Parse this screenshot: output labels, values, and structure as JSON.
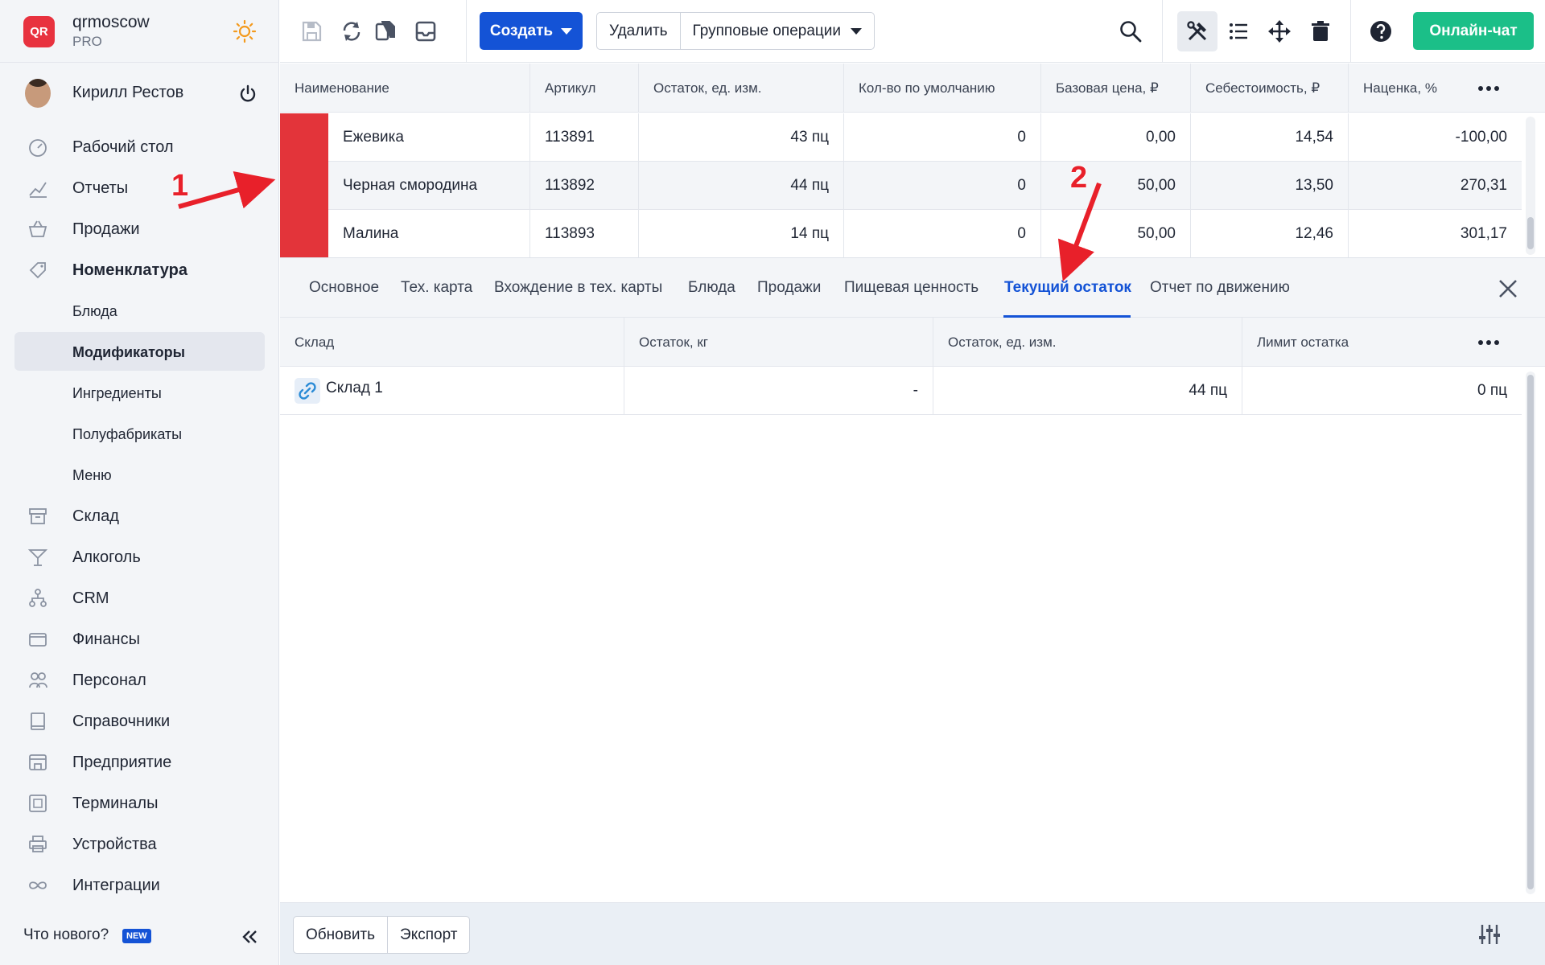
{
  "brand": {
    "name": "qrmoscow",
    "plan": "PRO",
    "logo_text": "QR"
  },
  "user": {
    "name": "Кирилл Рестов"
  },
  "nav": {
    "items": [
      {
        "label": "Рабочий стол",
        "icon": "dashboard-icon"
      },
      {
        "label": "Отчеты",
        "icon": "chart-icon"
      },
      {
        "label": "Продажи",
        "icon": "basket-icon"
      },
      {
        "label": "Номенклатура",
        "icon": "tag-icon"
      },
      {
        "label": "Блюда"
      },
      {
        "label": "Модификаторы"
      },
      {
        "label": "Ингредиенты"
      },
      {
        "label": "Полуфабрикаты"
      },
      {
        "label": "Меню"
      },
      {
        "label": "Склад",
        "icon": "archive-icon"
      },
      {
        "label": "Алкоголь",
        "icon": "cocktail-icon"
      },
      {
        "label": "CRM",
        "icon": "hierarchy-icon"
      },
      {
        "label": "Финансы",
        "icon": "wallet-icon"
      },
      {
        "label": "Персонал",
        "icon": "people-icon"
      },
      {
        "label": "Справочники",
        "icon": "book-icon"
      },
      {
        "label": "Предприятие",
        "icon": "store-icon"
      },
      {
        "label": "Терминалы",
        "icon": "qr-icon"
      },
      {
        "label": "Устройства",
        "icon": "printer-icon"
      },
      {
        "label": "Интеграции",
        "icon": "infinity-icon"
      }
    ],
    "whats_new": "Что нового?",
    "new_badge": "NEW"
  },
  "toolbar": {
    "create": "Создать",
    "delete": "Удалить",
    "group_ops": "Групповые операции",
    "chat": "Онлайн-чат"
  },
  "grid": {
    "columns": [
      "Наименование",
      "Артикул",
      "Остаток, ед. изм.",
      "Кол-во по умолчанию",
      "Базовая цена, ₽",
      "Себестоимость, ₽",
      "Наценка, %"
    ],
    "rows": [
      {
        "name": "Ежевика",
        "sku": "113891",
        "stock": "43 пц",
        "default_qty": "0",
        "base_price": "0,00",
        "cost": "14,54",
        "markup": "-100,00"
      },
      {
        "name": "Черная смородина",
        "sku": "113892",
        "stock": "44 пц",
        "default_qty": "0",
        "base_price": "50,00",
        "cost": "13,50",
        "markup": "270,31"
      },
      {
        "name": "Малина",
        "sku": "113893",
        "stock": "14 пц",
        "default_qty": "0",
        "base_price": "50,00",
        "cost": "12,46",
        "markup": "301,17"
      }
    ],
    "row_color": "#e3343a"
  },
  "detail": {
    "tabs": [
      "Основное",
      "Тех. карта",
      "Вхождение в тех. карты",
      "Блюда",
      "Продажи",
      "Пищевая ценность",
      "Текущий остаток",
      "Отчет по движению"
    ],
    "active_tab": "Текущий остаток",
    "columns": [
      "Склад",
      "Остаток, кг",
      "Остаток, ед. изм.",
      "Лимит остатка"
    ],
    "rows": [
      {
        "warehouse": "Склад 1",
        "stock_kg": "-",
        "stock_units": "44 пц",
        "limit": "0 пц"
      }
    ]
  },
  "footer": {
    "refresh": "Обновить",
    "export": "Экспорт"
  },
  "annotations": {
    "first": "1",
    "second": "2"
  },
  "colors": {
    "accent": "#1453d6",
    "chat": "#1bbf88",
    "annotation": "#e8202a"
  }
}
